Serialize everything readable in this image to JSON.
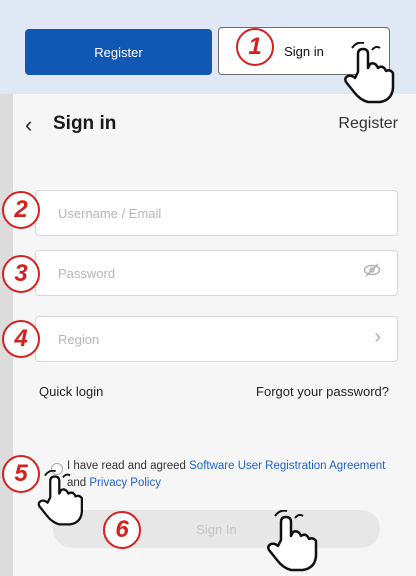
{
  "top": {
    "register_label": "Register",
    "signin_label": "Sign in"
  },
  "header": {
    "title": "Sign in",
    "register_link": "Register"
  },
  "form": {
    "username_placeholder": "Username / Email",
    "password_placeholder": "Password",
    "region_placeholder": "Region"
  },
  "links": {
    "quick_login": "Quick login",
    "forgot_password": "Forgot your password?"
  },
  "agreement": {
    "prefix": "I have read and agreed ",
    "link1": "Software User Registration Agreement",
    "middle": " and ",
    "link2": "Privacy Policy",
    "checked": false
  },
  "signin_button": "Sign In",
  "steps": [
    "1",
    "2",
    "3",
    "4",
    "5",
    "6"
  ],
  "colors": {
    "primary": "#1158b4",
    "step_red": "#d62020",
    "link_blue": "#1d62c8"
  },
  "icons": [
    "back-chevron-icon",
    "eye-hidden-icon",
    "chevron-right-icon",
    "tap-hand-icon"
  ]
}
